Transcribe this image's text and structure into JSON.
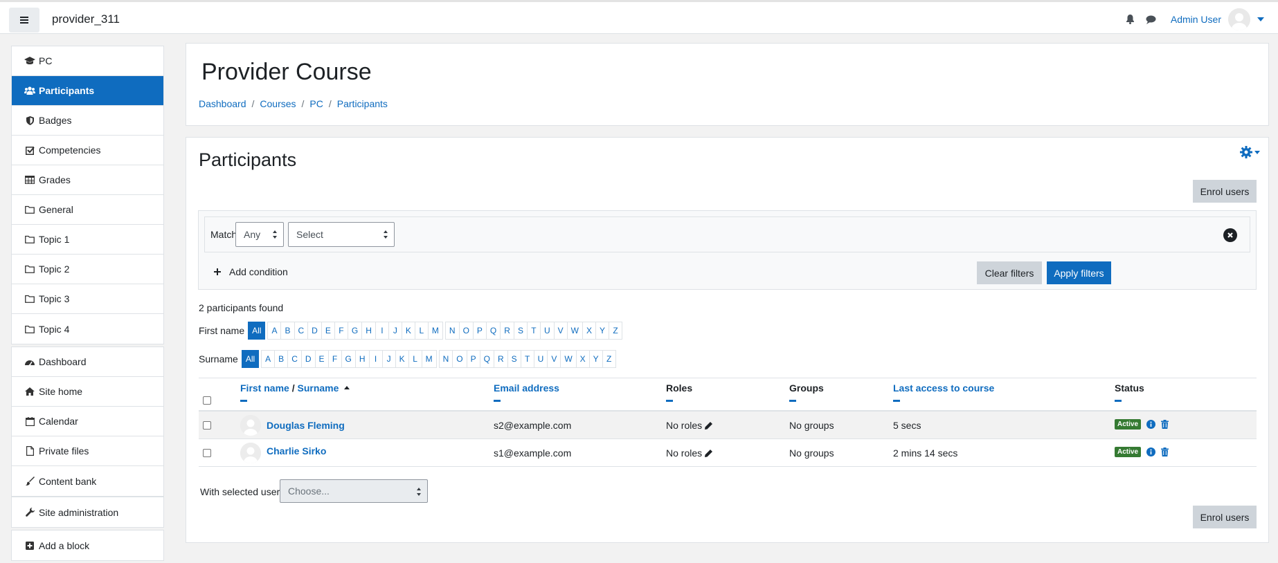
{
  "header": {
    "site_name": "provider_311",
    "user_name": "Admin User"
  },
  "nav": {
    "course_items": [
      {
        "label": "PC",
        "icon": "graduation-cap-icon"
      },
      {
        "label": "Participants",
        "icon": "users-icon",
        "active": true
      },
      {
        "label": "Badges",
        "icon": "shield-icon"
      },
      {
        "label": "Competencies",
        "icon": "check-square-icon"
      },
      {
        "label": "Grades",
        "icon": "table-icon"
      },
      {
        "label": "General",
        "icon": "folder-icon"
      },
      {
        "label": "Topic 1",
        "icon": "folder-icon"
      },
      {
        "label": "Topic 2",
        "icon": "folder-icon"
      },
      {
        "label": "Topic 3",
        "icon": "folder-icon"
      },
      {
        "label": "Topic 4",
        "icon": "folder-icon"
      }
    ],
    "site_items": [
      {
        "label": "Dashboard",
        "icon": "dashboard-icon"
      },
      {
        "label": "Site home",
        "icon": "home-icon"
      },
      {
        "label": "Calendar",
        "icon": "calendar-icon"
      },
      {
        "label": "Private files",
        "icon": "file-icon"
      },
      {
        "label": "Content bank",
        "icon": "paint-brush-icon"
      }
    ],
    "admin_item": {
      "label": "Site administration",
      "icon": "wrench-icon"
    },
    "block_item": {
      "label": "Add a block",
      "icon": "plus-square-icon"
    }
  },
  "course": {
    "title": "Provider Course",
    "breadcrumb": [
      "Dashboard",
      "Courses",
      "PC",
      "Participants"
    ]
  },
  "participants": {
    "title": "Participants",
    "enrol_label": "Enrol users",
    "filter": {
      "match_label": "Match",
      "match_value": "Any",
      "condition_value": "Select",
      "add_condition": "Add condition",
      "clear": "Clear filters",
      "apply": "Apply filters"
    },
    "found_text": "2 participants found",
    "firstname_label": "First name",
    "surname_label": "Surname",
    "letters_all": "All",
    "letters": [
      "A",
      "B",
      "C",
      "D",
      "E",
      "F",
      "G",
      "H",
      "I",
      "J",
      "K",
      "L",
      "M",
      "N",
      "O",
      "P",
      "Q",
      "R",
      "S",
      "T",
      "U",
      "V",
      "W",
      "X",
      "Y",
      "Z"
    ],
    "columns": {
      "first_name": "First name",
      "slash": " / ",
      "surname": "Surname",
      "email": "Email address",
      "roles": "Roles",
      "groups": "Groups",
      "last_access": "Last access to course",
      "status": "Status"
    },
    "rows": [
      {
        "name": "Douglas Fleming",
        "email": "s2@example.com",
        "roles": "No roles",
        "groups": "No groups",
        "last_access": "5 secs",
        "status": "Active"
      },
      {
        "name": "Charlie Sirko",
        "email": "s1@example.com",
        "roles": "No roles",
        "groups": "No groups",
        "last_access": "2 mins 14 secs",
        "status": "Active"
      }
    ],
    "with_selected_label": "With selected users...",
    "with_selected_placeholder": "Choose..."
  },
  "colors": {
    "primary": "#0f6cbf",
    "success": "#357a32",
    "secondary": "#ced4da"
  }
}
